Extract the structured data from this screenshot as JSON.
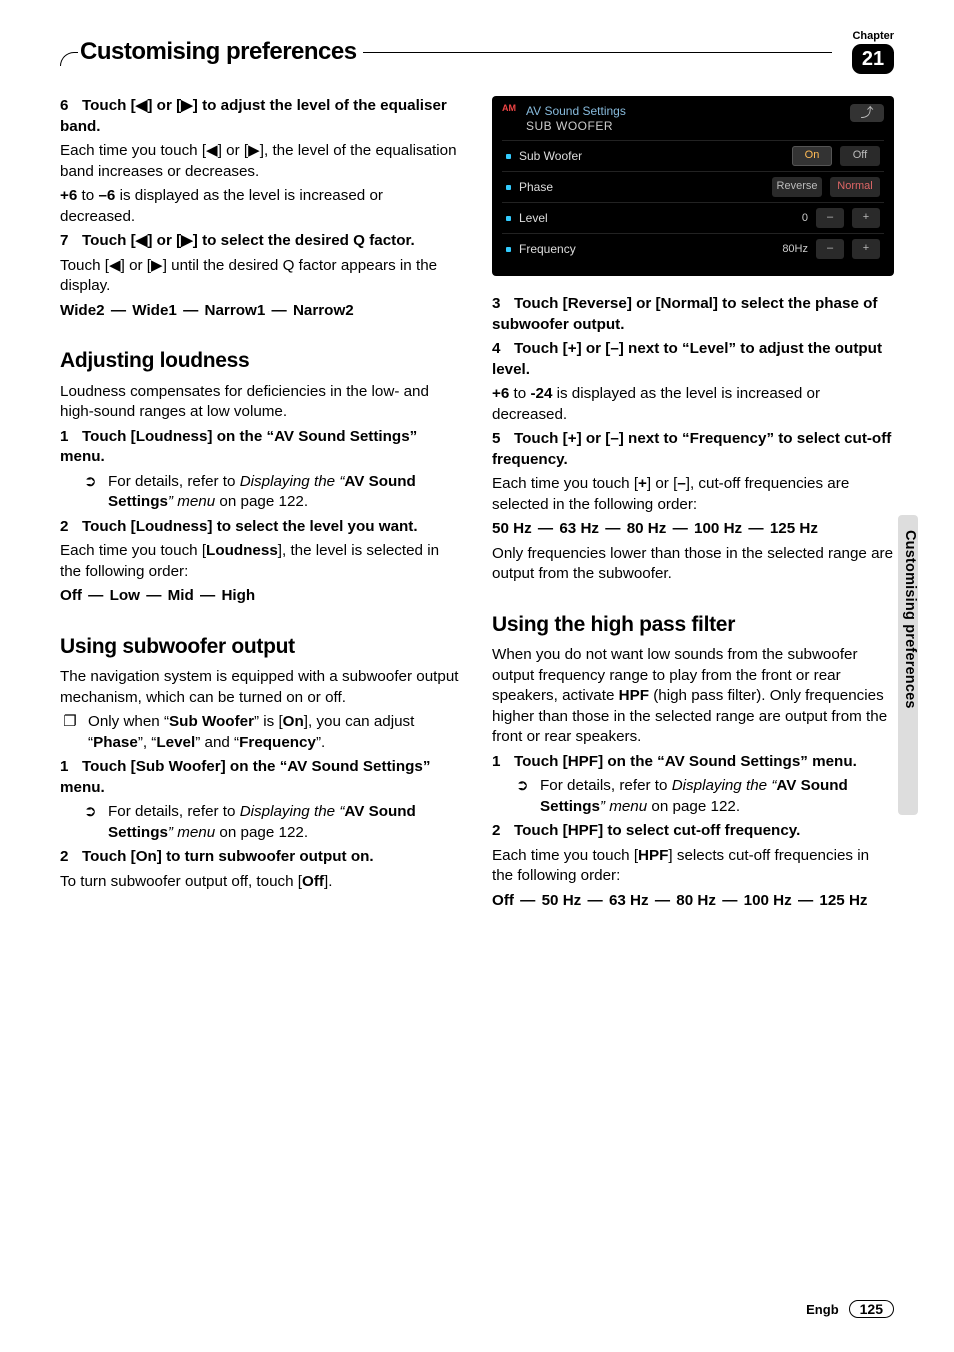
{
  "chapter": {
    "label": "Chapter",
    "number": "21"
  },
  "header_title": "Customising preferences",
  "side_tab": "Customising preferences",
  "left": {
    "step6": {
      "heading": "Touch [◀] or [▶] to adjust the level of the equaliser band.",
      "body1": "Each time you touch [◀] or [▶], the level of the equalisation band increases or decreases.",
      "body2a": "+6",
      "body2b": " to ",
      "body2c": "–6",
      "body2d": " is displayed as the level is increased or decreased."
    },
    "step7": {
      "heading": "Touch [◀] or [▶] to select the desired Q factor.",
      "body1": "Touch [◀] or [▶] until the desired Q factor appears in the display.",
      "opts": [
        "Wide2",
        "Wide1",
        "Narrow1",
        "Narrow2"
      ]
    },
    "loudness": {
      "title": "Adjusting loudness",
      "intro": "Loudness compensates for deficiencies in the low- and high-sound ranges at low volume.",
      "s1": "Touch [Loudness] on the “AV Sound Settings” menu.",
      "ref_pre": "For details, refer to ",
      "ref_it1": "Displaying the ",
      "ref_q": "“",
      "ref_b": "AV Sound Settings",
      "ref_it2": "” menu",
      "ref_post": " on page 122.",
      "s2": "Touch [Loudness] to select the level you want.",
      "s2b1": "Each time you touch [",
      "s2b2": "Loudness",
      "s2b3": "], the level is selected in the following order:",
      "opts": [
        "Off",
        "Low",
        "Mid",
        "High"
      ]
    },
    "subout": {
      "title": "Using subwoofer output",
      "intro": "The navigation system is equipped with a subwoofer output mechanism, which can be turned on or off.",
      "note1": "Only when “",
      "note1b": "Sub Woofer",
      "note1c": "” is [",
      "note1d": "On",
      "note1e": "], you can adjust “",
      "note1f": "Phase",
      "note1g": "”, “",
      "note1h": "Level",
      "note1i": "” and “",
      "note1j": "Frequency",
      "note1k": "”.",
      "s1": "Touch [Sub Woofer] on the “AV Sound Settings” menu.",
      "s2": "Touch [On] to turn subwoofer output on.",
      "s2b1": "To turn subwoofer output off, touch [",
      "s2b2": "Off",
      "s2b3": "]."
    }
  },
  "ui": {
    "am": "AM",
    "title1": "AV Sound Settings",
    "title2": "SUB WOOFER",
    "back": "⤴",
    "rows": {
      "sub": {
        "label": "Sub Woofer",
        "on": "On",
        "off": "Off"
      },
      "phase": {
        "label": "Phase",
        "rev": "Reverse",
        "norm": "Normal"
      },
      "level": {
        "label": "Level",
        "val": "0",
        "minus": "–",
        "plus": "+"
      },
      "freq": {
        "label": "Frequency",
        "val": "80Hz",
        "minus": "–",
        "plus": "+"
      }
    }
  },
  "right": {
    "s3": "Touch [Reverse] or [Normal] to select the phase of subwoofer output.",
    "s4": "Touch [+] or [–] next to “Level” to adjust the output level.",
    "s4b1": "+6",
    "s4b2": " to ",
    "s4b3": "-24",
    "s4b4": " is displayed as the level is increased or decreased.",
    "s5": "Touch [+] or [–] next to “Frequency” to select cut-off frequency.",
    "s5b1": "Each time you touch [",
    "s5b2": "+",
    "s5b3": "] or [",
    "s5b4": "–",
    "s5b5": "], cut-off frequencies are selected in the following order:",
    "freq_opts": [
      "50 Hz",
      "63 Hz",
      "80 Hz",
      "100 Hz",
      "125 Hz"
    ],
    "s5c": "Only frequencies lower than those in the selected range are output from the subwoofer.",
    "hpf": {
      "title": "Using the high pass filter",
      "intro1": "When you do not want low sounds from the subwoofer output frequency range to play from the front or rear speakers, activate ",
      "intro1b": "HPF",
      "intro1c": " (high pass filter). Only frequencies higher than those in the selected range are output from the front or rear speakers.",
      "s1": "Touch [HPF] on the “AV Sound Settings” menu.",
      "s2": "Touch [HPF] to select cut-off frequency.",
      "s2b1": "Each time you touch [",
      "s2b2": "HPF",
      "s2b3": "] selects cut-off frequencies in the following order:",
      "opts": [
        "Off",
        "50 Hz",
        "63 Hz",
        "80 Hz",
        "100 Hz",
        "125 Hz"
      ]
    }
  },
  "footer": {
    "lang": "Engb",
    "page": "125"
  },
  "dash": "—"
}
